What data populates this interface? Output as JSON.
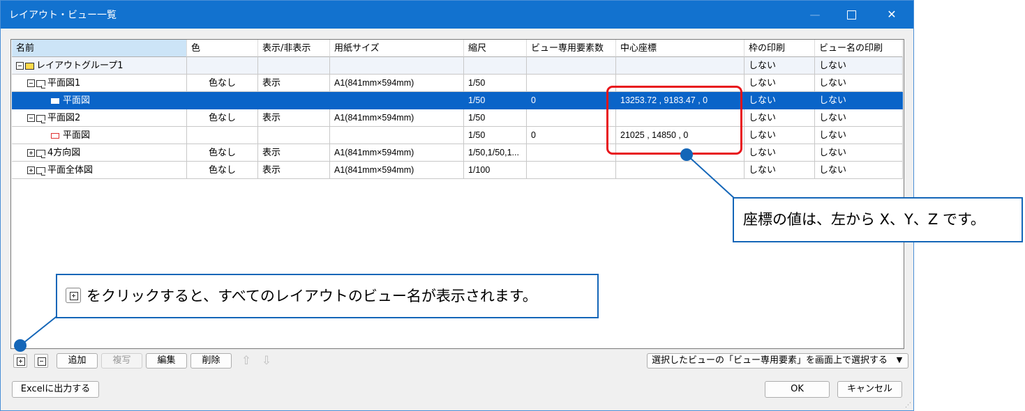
{
  "window": {
    "title": "レイアウト・ビュー一覧",
    "controls": {
      "minimize": "—",
      "maximize": "",
      "close": "✕"
    }
  },
  "table": {
    "headers": [
      "名前",
      "色",
      "表示/非表示",
      "用紙サイズ",
      "縮尺",
      "ビュー専用要素数",
      "中心座標",
      "枠の印刷",
      "ビュー名の印刷"
    ],
    "rows": [
      {
        "name": "レイアウトグループ1",
        "color": "",
        "display": "",
        "paper": "",
        "scale": "",
        "count": "",
        "center": "",
        "frame": "しない",
        "viewname": "しない"
      },
      {
        "name": "平面図1",
        "color": "色なし",
        "display": "表示",
        "paper": "A1(841mm×594mm)",
        "scale": "1/50",
        "count": "",
        "center": "",
        "frame": "しない",
        "viewname": "しない"
      },
      {
        "name": "平面図",
        "color": "",
        "display": "",
        "paper": "",
        "scale": "1/50",
        "count": "0",
        "center": "13253.72 , 9183.47 , 0",
        "frame": "しない",
        "viewname": "しない"
      },
      {
        "name": "平面図2",
        "color": "色なし",
        "display": "表示",
        "paper": "A1(841mm×594mm)",
        "scale": "1/50",
        "count": "",
        "center": "",
        "frame": "しない",
        "viewname": "しない"
      },
      {
        "name": "平面図",
        "color": "",
        "display": "",
        "paper": "",
        "scale": "1/50",
        "count": "0",
        "center": "21025 , 14850 , 0",
        "frame": "しない",
        "viewname": "しない"
      },
      {
        "name": "4方向図",
        "color": "色なし",
        "display": "表示",
        "paper": "A1(841mm×594mm)",
        "scale": "1/50,1/50,1...",
        "count": "",
        "center": "",
        "frame": "しない",
        "viewname": "しない"
      },
      {
        "name": "平面全体図",
        "color": "色なし",
        "display": "表示",
        "paper": "A1(841mm×594mm)",
        "scale": "1/100",
        "count": "",
        "center": "",
        "frame": "しない",
        "viewname": "しない"
      }
    ]
  },
  "toolbar": {
    "add": "追加",
    "copy": "複写",
    "edit": "編集",
    "delete": "削除",
    "up_arrow": "⇧",
    "down_arrow": "⇩",
    "select_view_elements": "選択したビューの「ビュー専用要素」を画面上で選択する",
    "dropdown_arrow": "▼"
  },
  "footer": {
    "excel": "Excelに出力する",
    "ok": "OK",
    "cancel": "キャンセル"
  },
  "annotations": {
    "coords_note": "座標の値は、左から X、Y、Z です。",
    "expand_note": "をクリックすると、すべてのレイアウトのビュー名が表示されます。"
  },
  "colors": {
    "titlebar": "#1272cf",
    "selection": "#0a64c8",
    "highlight_box": "#e8151b",
    "callout": "#1466b8"
  }
}
